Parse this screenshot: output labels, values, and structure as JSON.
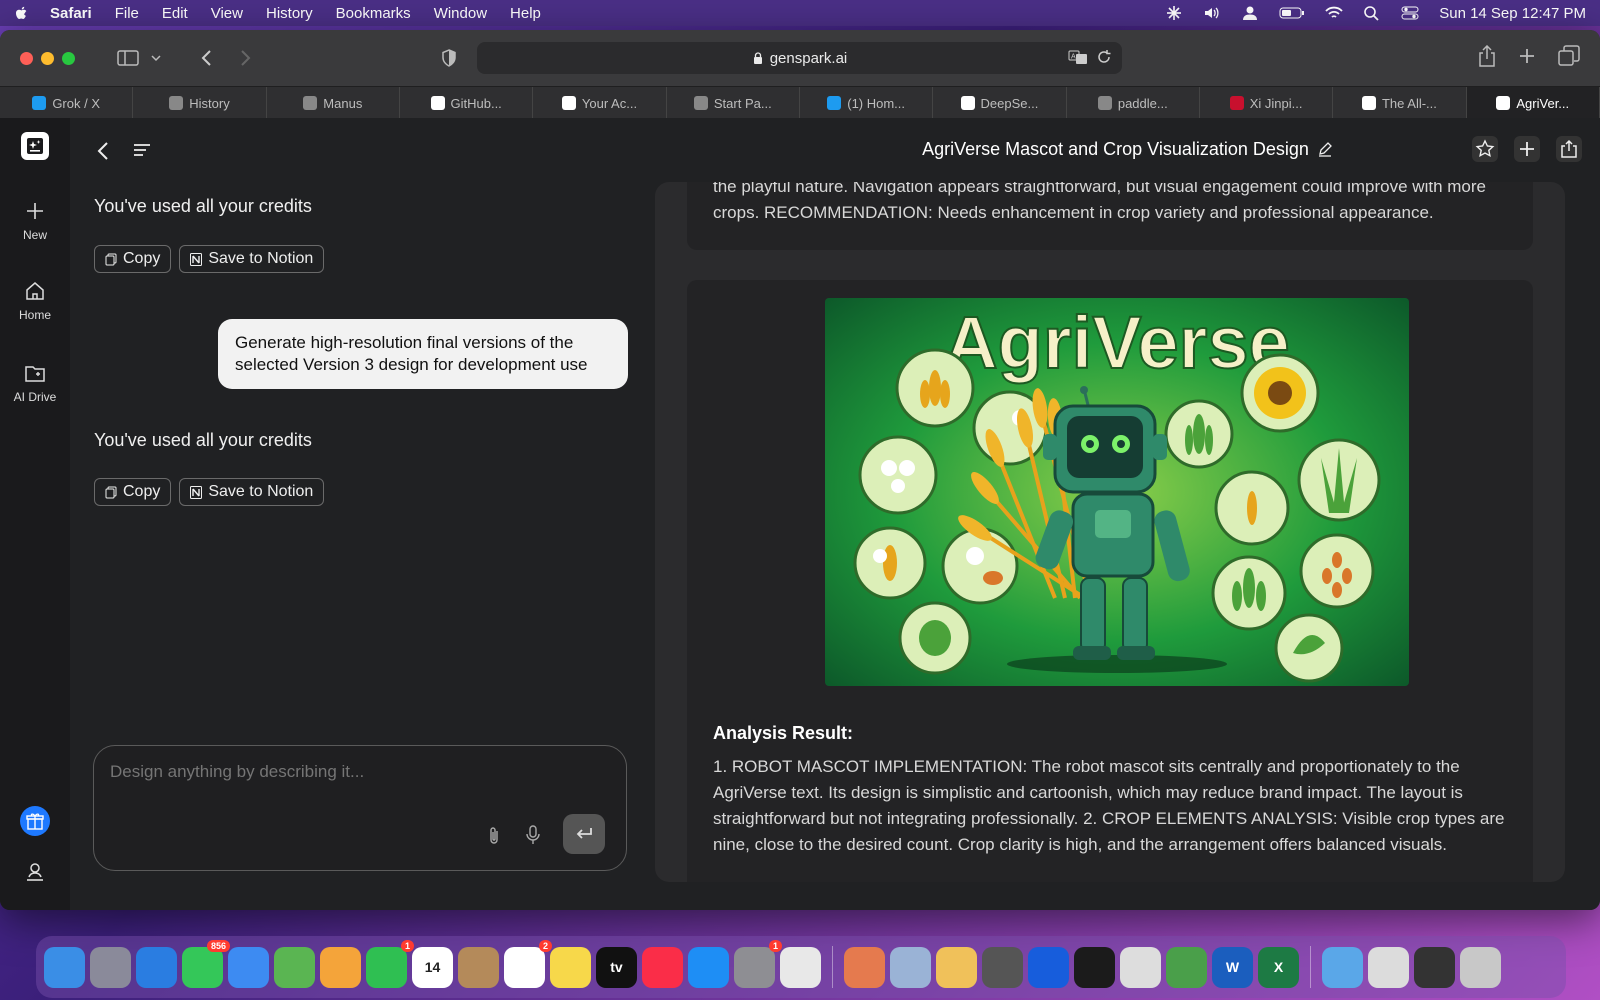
{
  "menubar": {
    "app": "Safari",
    "items": [
      "File",
      "Edit",
      "View",
      "History",
      "Bookmarks",
      "Window",
      "Help"
    ],
    "datetime": "Sun 14 Sep  12:47 PM"
  },
  "browser": {
    "url": "genspark.ai",
    "tabs": [
      {
        "label": "Grok / X",
        "icon": "x-icon",
        "color": "#1d9bf0"
      },
      {
        "label": "History",
        "icon": "clock-icon",
        "color": "#888888"
      },
      {
        "label": "Manus",
        "icon": "manus-icon",
        "color": "#888888"
      },
      {
        "label": "GitHub...",
        "icon": "github-icon",
        "color": "#ffffff"
      },
      {
        "label": "Your Ac...",
        "icon": "amazon-icon",
        "color": "#ffffff"
      },
      {
        "label": "Start Pa...",
        "icon": "star-icon",
        "color": "#888888"
      },
      {
        "label": "(1) Hom...",
        "icon": "x-icon",
        "color": "#1d9bf0"
      },
      {
        "label": "DeepSe...",
        "icon": "openai-icon",
        "color": "#ffffff"
      },
      {
        "label": "paddle...",
        "icon": "g-icon",
        "color": "#888888"
      },
      {
        "label": "Xi Jinpi...",
        "icon": "n-icon",
        "color": "#c8102e"
      },
      {
        "label": "The All-...",
        "icon": "genspark-icon",
        "color": "#ffffff"
      },
      {
        "label": "AgriVer...",
        "icon": "genspark-icon",
        "color": "#ffffff",
        "active": true
      }
    ]
  },
  "sidebar": {
    "items": [
      {
        "label": "New",
        "icon": "plus-icon"
      },
      {
        "label": "Home",
        "icon": "home-icon"
      },
      {
        "label": "AI Drive",
        "icon": "folder-icon"
      }
    ]
  },
  "chat": {
    "credits_msg_1": "You've used all your credits",
    "credits_msg_2": "You've used all your credits",
    "copy_label": "Copy",
    "notion_label": "Save to Notion",
    "user_message": "Generate high-resolution final versions of the selected Version 3 design for development use",
    "composer_placeholder": "Design anything by describing it..."
  },
  "main": {
    "title": "AgriVerse Mascot and Crop Visualization Design",
    "prev_text": "the playful nature. Navigation appears straightforward, but visual engagement could improve with more crops. RECOMMENDATION: Needs enhancement in crop variety and professional appearance.",
    "image_title": "AgriVerse",
    "analysis_heading": "Analysis Result:",
    "analysis_text": "1. ROBOT MASCOT IMPLEMENTATION: The robot mascot sits centrally and proportionately to the AgriVerse text. Its design is simplistic and cartoonish, which may reduce brand impact. The layout is straightforward but not integrating professionally. 2. CROP ELEMENTS ANALYSIS: Visible crop types are nine, close to the desired count. Crop clarity is high, and the arrangement offers balanced visuals."
  },
  "dock": {
    "apps": [
      {
        "name": "finder",
        "color": "#3a8ee6"
      },
      {
        "name": "launchpad",
        "color": "#8a8a9a"
      },
      {
        "name": "safari",
        "color": "#2a7de1"
      },
      {
        "name": "messages",
        "color": "#34c759",
        "badge": "856"
      },
      {
        "name": "mail",
        "color": "#3d8bf2"
      },
      {
        "name": "maps",
        "color": "#5ab552"
      },
      {
        "name": "photos",
        "color": "#f4a43a"
      },
      {
        "name": "facetime",
        "color": "#2fbf52",
        "badge": "1"
      },
      {
        "name": "calendar",
        "color": "#ffffff",
        "label": "14"
      },
      {
        "name": "contacts",
        "color": "#b48a5a"
      },
      {
        "name": "reminders",
        "color": "#ffffff",
        "badge": "2"
      },
      {
        "name": "notes",
        "color": "#f7d84a"
      },
      {
        "name": "tv",
        "color": "#111111",
        "label": "tv"
      },
      {
        "name": "music",
        "color": "#fa2d48"
      },
      {
        "name": "app-store",
        "color": "#1e8ef5"
      },
      {
        "name": "system-settings",
        "color": "#8e8e93",
        "badge": "1"
      },
      {
        "name": "chrome",
        "color": "#e8e8e8"
      },
      {
        "name": "claude",
        "color": "#e57a4e"
      },
      {
        "name": "preview",
        "color": "#9ab3d6"
      },
      {
        "name": "feather",
        "color": "#f0c15a"
      },
      {
        "name": "screenshot",
        "color": "#555555"
      },
      {
        "name": "bitwarden",
        "color": "#175ddc"
      },
      {
        "name": "terminal",
        "color": "#1b1b1b"
      },
      {
        "name": "script-editor",
        "color": "#dddddd"
      },
      {
        "name": "installer",
        "color": "#4a9f4a"
      },
      {
        "name": "word",
        "color": "#1b5ebe",
        "label": "W"
      },
      {
        "name": "excel",
        "color": "#1d7a44",
        "label": "X"
      },
      {
        "name": "downloads-folder",
        "color": "#5aa7e8"
      },
      {
        "name": "documents-stack",
        "color": "#dcdcdc"
      },
      {
        "name": "screens-stack",
        "color": "#333333"
      },
      {
        "name": "trash",
        "color": "#c8c8c8"
      }
    ]
  }
}
